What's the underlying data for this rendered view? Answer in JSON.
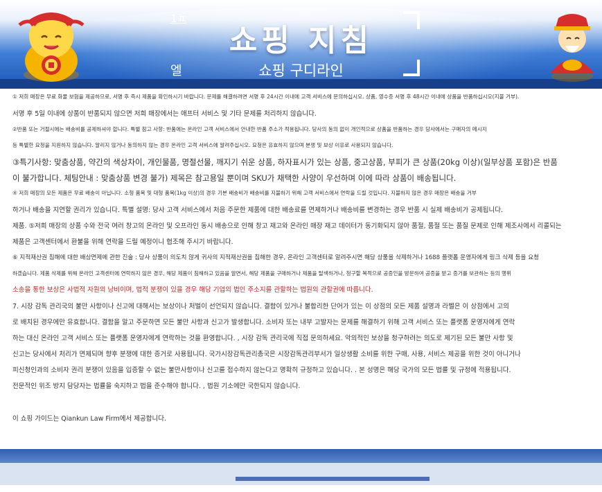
{
  "header": {
    "title": "쇼핑 지침",
    "subtitle": "쇼핑 구디라인",
    "small_top": "1ㅍ",
    "small_bottom": "엘"
  },
  "content": {
    "lines": [
      "① 저희 매장은 무료 화물 보험을 제공하므로, 서명 후 즉시 제품을 확인하시기 바랍니다. 문제를 해결하려면 서명 후 24시간 이내에 고객 서비스에 문의하십시오. 상품, 영수증 서명 후 48시간 이내에 상품을 반품하십시오(지불 거부).",
      "서명 후 5일 이내에 상품이 반품되지 않으면 저희 매장에서는 애프터 서비스 및 기타 문제를 처리하지 않습니다.",
      "②반품 또는 거절시에는 배송비를 공제하셔야 합니다. 특별 참고 사항: 반품에는 온라인 고객 서비스에서 안내한 반품 주소가 적용됩니다. 당사의 동의 없이 개인적으로 상품을 반품하는 경우 당사에서는 구매자의 메시지",
      "등 특별한 요청을 지원하지 않습니다. 알리지 않거나 동의하지 않는 경우 온라인 고객 서비스에 알려주십시오. 요청은 유효하지 않으며 분쟁 및 보상 이유로 사용되지 않습니다.",
      "③특기사항: 맞춤상품, 약간의 색상차이, 개인물품, 명절선물, 깨지기 쉬운 상품, 하자표시가 있는 상품, 중고상품, 부피가 큰 상품(20kg 이상)(일부상품 포함)은 반품",
      "이 불가합니다. 체팅안내 : 맞춤상품 변경 불가) 제목은 참고용일 뿐이며 SKU가 채택한 사양이 우선하며 이에 따라 상품이 배송됩니다.",
      "④ 저희 매장의 모든 제품은 무료 배송이 아닙니다. 소형 품목 및 대형 품목(1kg 이상)의 경우 기본 배송비가 배송비를 지불하기 위해 고객 서비스에서 연락을 드릴 것입니다. 지불하지 않은 경우 매장은 배송을 거부",
      "하거나 배송을 지연할 권리가 있습니다. 특별 설명: 당사 고객 서비스에서 처음 주문한 제품에 대한 배송료를 면제하거나 배송비를 변경하는 경우 반품 시 실제 배송비가 공제됩니다.",
      "제품. ⑤저희 매장의 상품 수와 전국 여러 창고의 온라인 및 오프라인 동시 배송으로 인해 창고 재고와 온라인 매장 재고 데이터가 동기화되지 않아 품절, 품절 또는 품질 문제로 인해 제조사에서 리콜되는",
      "제품은 고객센터에서 환불을 위해 연락을 드릴 예정이니 협조해 주시기 바랍니다.",
      "⑥ 지적재산권 침해에 대한 배상면제에 관한 진술 : 당사 상품이 의도치 않게 귀사의 지적재산권을 침해한 경우, 온라인 고객센터로 알려주시면 해당 상품을 삭제하거나 1688 플랫폼 운영자에게 링크 삭제 등을 요청",
      "하겠습니다. 제품 삭제를 위해 온라인 고객센터에 연락하지 않은 경우, 해당 제품이 침해하고 있음을 알면서, 해당 제품을 구매하거나 제품을 탈색하거나, 청구할 목적으로 공증인을 방문하여 공증을 받고 증거를 보관하는 등의 행위",
      "소송을 통한 보상은 사법적 자원의 낭비이며, 법적 분쟁이 있을 경우 해당 기업의 법인 주소지를 관할하는 법원의 관할권에 따릅니다.",
      "7. 시장 감독 관리국의 불만 사항이나 신고에 대해서는 보상이나 처벌이 선언되지 않습니다. 결함이 있거나 불합리한 단어가 있는 이 상점의 모든 제품 설명과 라벨은 이 상점에서 고의",
      "로 배치된 경우에만 유효합니다. 결함을 알고 주문하면 모든 불만 사항과 신고가 발생합니다. 소비자 또는 내부 고발자는 문제를 해결하기 위해 고객 서비스 또는 플랫폼 운영자에게 연락",
      "하는 대신 온라인 고객 서비스 또는 플랫폼 운영자에게 연락하는 것을 환영합니다. , 시장 감독 관리국에 직접 문의하세요. 악의적인 보상을 청구하려는 의도로 제기된 모든 불만 사항 및",
      "신고는 당사에서 처리가 면제되며 향후 분쟁에 대한 증거로 사용됩니다. 국가시장감독관리총국은 시장감독관리부서가 일상생활 소비를 위한 구매, 사용, 서비스 제공을 위한 것이 아니거나",
      "피신청인과의 소비자 권리 분쟁이 있음을 입증할 수 없는 불만사항이나 신고를 접수하지 않는다고 명확히 규정하고 있습니다. . 본 성명은 해당 국가의 모든 법률 및 규정에 적용됩니다.",
      "전문적인 위조 방지 담당자는 법률을 숙지하고 법을 준수해야 합니다. , 법원 기소에만 국한되지 않습니다.",
      "이 쇼핑 가이드는 Qiankun Law Firm에서 제공합니다."
    ]
  },
  "colors": {
    "accent_blue": "#1b56b8",
    "red_text": "#cc1b1b"
  },
  "icons": {
    "left": "golden-lucky-cat-mascot",
    "right": "god-of-wealth-mascot"
  }
}
